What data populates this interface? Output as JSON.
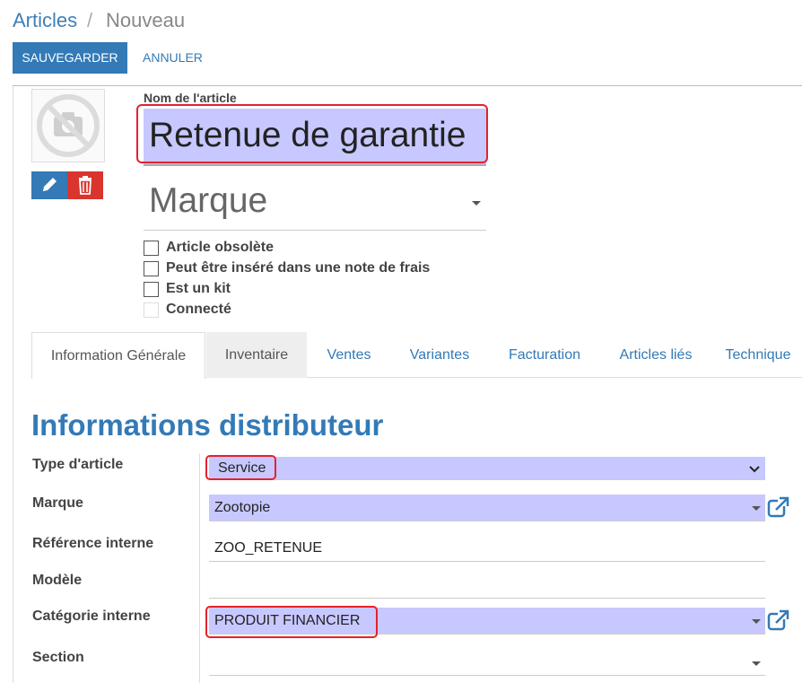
{
  "breadcrumb": {
    "parent": "Articles",
    "separator": "/",
    "current": "Nouveau"
  },
  "toolbar": {
    "save_label": "SAUVEGARDER",
    "cancel_label": "ANNULER"
  },
  "form": {
    "name_label": "Nom de l'article",
    "name_value": "Retenue de garantie",
    "brand_value": "Marque",
    "checkboxes": [
      {
        "label": "Article obsolète"
      },
      {
        "label": "Peut être inséré dans une note de frais"
      },
      {
        "label": "Est un kit"
      },
      {
        "label": "Connecté"
      }
    ]
  },
  "tabs": [
    {
      "label": "Information Générale"
    },
    {
      "label": "Inventaire"
    },
    {
      "label": "Ventes"
    },
    {
      "label": "Variantes"
    },
    {
      "label": "Facturation"
    },
    {
      "label": "Articles liés"
    },
    {
      "label": "Technique"
    }
  ],
  "section": {
    "title": "Informations distributeur",
    "fields": [
      {
        "label": "Type d'article",
        "value": "Service"
      },
      {
        "label": "Marque",
        "value": "Zootopie"
      },
      {
        "label": "Référence interne",
        "value": "ZOO_RETENUE"
      },
      {
        "label": "Modèle",
        "value": ""
      },
      {
        "label": "Catégorie interne",
        "value": "PRODUIT FINANCIER"
      },
      {
        "label": "Section",
        "value": ""
      }
    ]
  },
  "colors": {
    "primary": "#337ab7",
    "danger": "#d9352e",
    "highlight": "#c7c8ff",
    "annotation": "#e5212c"
  },
  "icons": [
    "camera-disabled-icon",
    "pencil-icon",
    "trash-icon",
    "external-link-icon",
    "chevron-down-icon",
    "caret-down-icon"
  ]
}
